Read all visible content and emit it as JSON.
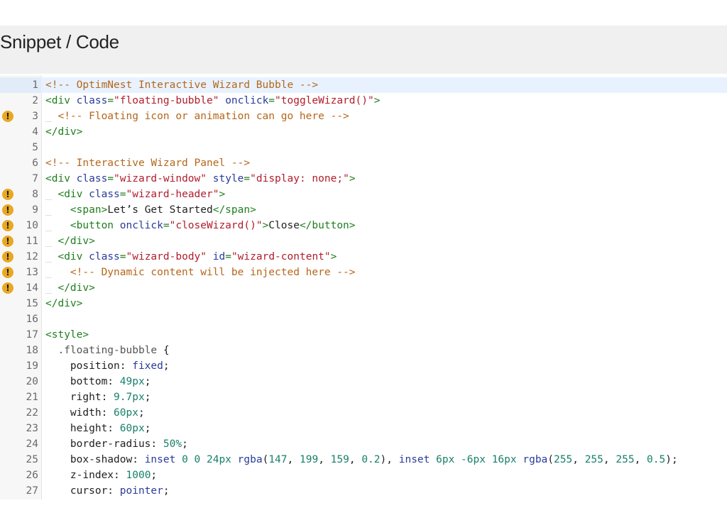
{
  "header": {
    "title": "Snippet / Code"
  },
  "editor": {
    "active_line": 1,
    "lines": [
      {
        "n": "1",
        "warn": false,
        "indent": "",
        "tokens": [
          {
            "t": "<!-- OptimNest Interactive Wizard Bubble -->",
            "c": "comment"
          }
        ]
      },
      {
        "n": "2",
        "warn": false,
        "indent": "",
        "tokens": [
          {
            "t": "<div ",
            "c": "tag"
          },
          {
            "t": "class",
            "c": "attr"
          },
          {
            "t": "=",
            "c": "tag"
          },
          {
            "t": "\"floating-bubble\"",
            "c": "string"
          },
          {
            "t": " ",
            "c": "text"
          },
          {
            "t": "onclick",
            "c": "attr"
          },
          {
            "t": "=",
            "c": "tag"
          },
          {
            "t": "\"toggleWizard()\"",
            "c": "string"
          },
          {
            "t": ">",
            "c": "tag"
          }
        ]
      },
      {
        "n": "3",
        "warn": true,
        "indent": "_",
        "tokens": [
          {
            "t": " <!-- Floating icon or animation can go here -->",
            "c": "comment"
          }
        ]
      },
      {
        "n": "4",
        "warn": false,
        "indent": "",
        "tokens": [
          {
            "t": "</div>",
            "c": "tag"
          }
        ]
      },
      {
        "n": "5",
        "warn": false,
        "indent": "",
        "tokens": []
      },
      {
        "n": "6",
        "warn": false,
        "indent": "",
        "tokens": [
          {
            "t": "<!-- Interactive Wizard Panel -->",
            "c": "comment"
          }
        ]
      },
      {
        "n": "7",
        "warn": false,
        "indent": "",
        "tokens": [
          {
            "t": "<div ",
            "c": "tag"
          },
          {
            "t": "class",
            "c": "attr"
          },
          {
            "t": "=",
            "c": "tag"
          },
          {
            "t": "\"wizard-window\"",
            "c": "string"
          },
          {
            "t": " ",
            "c": "text"
          },
          {
            "t": "style",
            "c": "attr"
          },
          {
            "t": "=",
            "c": "tag"
          },
          {
            "t": "\"display: none;\"",
            "c": "string"
          },
          {
            "t": ">",
            "c": "tag"
          }
        ]
      },
      {
        "n": "8",
        "warn": true,
        "indent": "_",
        "tokens": [
          {
            "t": " <div ",
            "c": "tag"
          },
          {
            "t": "class",
            "c": "attr"
          },
          {
            "t": "=",
            "c": "tag"
          },
          {
            "t": "\"wizard-header\"",
            "c": "string"
          },
          {
            "t": ">",
            "c": "tag"
          }
        ]
      },
      {
        "n": "9",
        "warn": true,
        "indent": "_",
        "tokens": [
          {
            "t": "   <span>",
            "c": "tag"
          },
          {
            "t": "Let’s Get Started",
            "c": "text"
          },
          {
            "t": "</span>",
            "c": "tag"
          }
        ]
      },
      {
        "n": "10",
        "warn": true,
        "indent": "_",
        "tokens": [
          {
            "t": "   <button ",
            "c": "tag"
          },
          {
            "t": "onclick",
            "c": "attr"
          },
          {
            "t": "=",
            "c": "tag"
          },
          {
            "t": "\"closeWizard()\"",
            "c": "string"
          },
          {
            "t": ">",
            "c": "tag"
          },
          {
            "t": "Close",
            "c": "text"
          },
          {
            "t": "</button>",
            "c": "tag"
          }
        ]
      },
      {
        "n": "11",
        "warn": true,
        "indent": "_",
        "tokens": [
          {
            "t": " </div>",
            "c": "tag"
          }
        ]
      },
      {
        "n": "12",
        "warn": true,
        "indent": "_",
        "tokens": [
          {
            "t": " <div ",
            "c": "tag"
          },
          {
            "t": "class",
            "c": "attr"
          },
          {
            "t": "=",
            "c": "tag"
          },
          {
            "t": "\"wizard-body\"",
            "c": "string"
          },
          {
            "t": " ",
            "c": "text"
          },
          {
            "t": "id",
            "c": "attr"
          },
          {
            "t": "=",
            "c": "tag"
          },
          {
            "t": "\"wizard-content\"",
            "c": "string"
          },
          {
            "t": ">",
            "c": "tag"
          }
        ]
      },
      {
        "n": "13",
        "warn": true,
        "indent": "_",
        "tokens": [
          {
            "t": "   <!-- Dynamic content will be injected here -->",
            "c": "comment"
          }
        ]
      },
      {
        "n": "14",
        "warn": true,
        "indent": "_",
        "tokens": [
          {
            "t": " </div>",
            "c": "tag"
          }
        ]
      },
      {
        "n": "15",
        "warn": false,
        "indent": "",
        "tokens": [
          {
            "t": "</div>",
            "c": "tag"
          }
        ]
      },
      {
        "n": "16",
        "warn": false,
        "indent": "",
        "tokens": []
      },
      {
        "n": "17",
        "warn": false,
        "indent": "",
        "tokens": [
          {
            "t": "<style>",
            "c": "tag"
          }
        ]
      },
      {
        "n": "18",
        "warn": false,
        "indent": "",
        "tokens": [
          {
            "t": "  .floating-bubble",
            "c": "selector"
          },
          {
            "t": " {",
            "c": "text"
          }
        ]
      },
      {
        "n": "19",
        "warn": false,
        "indent": "",
        "tokens": [
          {
            "t": "    position: ",
            "c": "prop"
          },
          {
            "t": "fixed",
            "c": "kw"
          },
          {
            "t": ";",
            "c": "text"
          }
        ]
      },
      {
        "n": "20",
        "warn": false,
        "indent": "",
        "tokens": [
          {
            "t": "    bottom: ",
            "c": "prop"
          },
          {
            "t": "49px",
            "c": "num"
          },
          {
            "t": ";",
            "c": "text"
          }
        ]
      },
      {
        "n": "21",
        "warn": false,
        "indent": "",
        "tokens": [
          {
            "t": "    right: ",
            "c": "prop"
          },
          {
            "t": "9.7px",
            "c": "num"
          },
          {
            "t": ";",
            "c": "text"
          }
        ]
      },
      {
        "n": "22",
        "warn": false,
        "indent": "",
        "tokens": [
          {
            "t": "    width: ",
            "c": "prop"
          },
          {
            "t": "60px",
            "c": "num"
          },
          {
            "t": ";",
            "c": "text"
          }
        ]
      },
      {
        "n": "23",
        "warn": false,
        "indent": "",
        "tokens": [
          {
            "t": "    height: ",
            "c": "prop"
          },
          {
            "t": "60px",
            "c": "num"
          },
          {
            "t": ";",
            "c": "text"
          }
        ]
      },
      {
        "n": "24",
        "warn": false,
        "indent": "",
        "tokens": [
          {
            "t": "    border-radius: ",
            "c": "prop"
          },
          {
            "t": "50%",
            "c": "num"
          },
          {
            "t": ";",
            "c": "text"
          }
        ]
      },
      {
        "n": "25",
        "warn": false,
        "indent": "",
        "tokens": [
          {
            "t": "    box-shadow: ",
            "c": "prop"
          },
          {
            "t": "inset",
            "c": "kw"
          },
          {
            "t": " ",
            "c": "text"
          },
          {
            "t": "0 0 24px",
            "c": "num"
          },
          {
            "t": " ",
            "c": "text"
          },
          {
            "t": "rgba",
            "c": "kw"
          },
          {
            "t": "(",
            "c": "text"
          },
          {
            "t": "147",
            "c": "num"
          },
          {
            "t": ", ",
            "c": "text"
          },
          {
            "t": "199",
            "c": "num"
          },
          {
            "t": ", ",
            "c": "text"
          },
          {
            "t": "159",
            "c": "num"
          },
          {
            "t": ", ",
            "c": "text"
          },
          {
            "t": "0.2",
            "c": "num"
          },
          {
            "t": "), ",
            "c": "text"
          },
          {
            "t": "inset",
            "c": "kw"
          },
          {
            "t": " ",
            "c": "text"
          },
          {
            "t": "6px -6px 16px",
            "c": "num"
          },
          {
            "t": " ",
            "c": "text"
          },
          {
            "t": "rgba",
            "c": "kw"
          },
          {
            "t": "(",
            "c": "text"
          },
          {
            "t": "255",
            "c": "num"
          },
          {
            "t": ", ",
            "c": "text"
          },
          {
            "t": "255",
            "c": "num"
          },
          {
            "t": ", ",
            "c": "text"
          },
          {
            "t": "255",
            "c": "num"
          },
          {
            "t": ", ",
            "c": "text"
          },
          {
            "t": "0.5",
            "c": "num"
          },
          {
            "t": ");",
            "c": "text"
          }
        ]
      },
      {
        "n": "26",
        "warn": false,
        "indent": "",
        "tokens": [
          {
            "t": "    z-index: ",
            "c": "prop"
          },
          {
            "t": "1000",
            "c": "num"
          },
          {
            "t": ";",
            "c": "text"
          }
        ]
      },
      {
        "n": "27",
        "warn": false,
        "indent": "",
        "tokens": [
          {
            "t": "    cursor: ",
            "c": "prop"
          },
          {
            "t": "pointer",
            "c": "kw"
          },
          {
            "t": ";",
            "c": "text"
          }
        ]
      }
    ]
  },
  "icons": {
    "warning": "warning-icon"
  },
  "colors": {
    "header_bg": "#f0f0f0",
    "warning": "#e9a823",
    "active_line": "#e8f2ff"
  }
}
